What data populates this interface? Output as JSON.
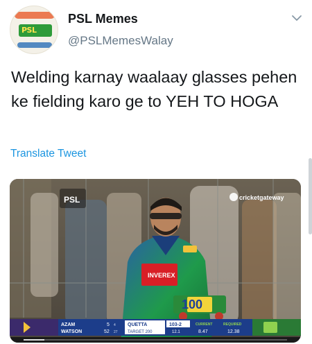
{
  "tweet": {
    "display_name": "PSL Memes",
    "handle": "@PSLMemesWalay",
    "avatar_text": "PSL",
    "text": "Welding karnay waalaay glasses pehen ke fielding karo ge to YEH TO HOGA",
    "translate_label": "Translate Tweet"
  },
  "media": {
    "logo_left": "PSL",
    "watermark": "cricketgateway",
    "sponsor": "INVEREX",
    "sign_number": "100",
    "scoreboard": {
      "batsman1": "AZAM",
      "batsman1_score": "5",
      "batsman1_balls": "4",
      "batsman2": "WATSON",
      "batsman2_score": "52",
      "batsman2_balls": "27",
      "team": "QUETTA",
      "score": "103-2",
      "target_label": "TARGET 200",
      "overs": "12.1",
      "current_label": "CURRENT",
      "current_rate": "8.47",
      "required_label": "REQUIRED",
      "required_rate": "12.38"
    }
  },
  "colors": {
    "link": "#1b95e0",
    "secondary_text": "#657786",
    "primary_text": "#14171a",
    "scoreboard_bg": "#1c3d8a",
    "jersey_green": "#1f9a4b"
  }
}
